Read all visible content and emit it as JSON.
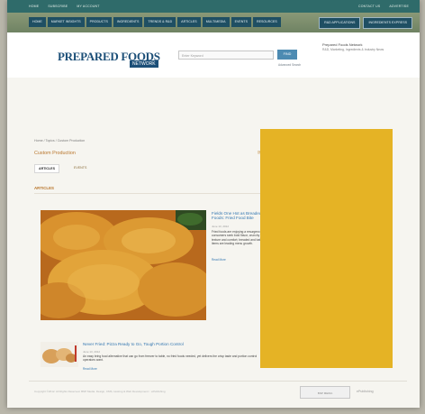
{
  "utility_bar": {
    "left_links": [
      "HOME",
      "SUBSCRIBE",
      "MY ACCOUNT"
    ],
    "right_links": [
      "CONTACT US",
      "ADVERTISE"
    ]
  },
  "nav": {
    "items": [
      "HOME",
      "MARKET INSIGHTS",
      "PRODUCTS",
      "INGREDIENTS",
      "TRENDS & R&D",
      "ARTICLES",
      "MULTIMEDIA",
      "EVENTS",
      "RESOURCES"
    ],
    "special": [
      "R&D APPLICATIONS",
      "INGREDIENTS EXPRESS"
    ]
  },
  "header": {
    "logo_main": "PREPARED FOODS",
    "logo_sub": "NETWORK",
    "search_placeholder": "Enter Keyword",
    "search_button": "FIND",
    "advanced_search": "Advanced Search",
    "promo_title": "Prepared Foods Network",
    "promo_text": "R&D, Marketing, Ingredients & Industry News"
  },
  "breadcrumbs": "Home / Topics / Custom Production",
  "page_title": "Custom Production",
  "tabs": [
    "ARTICLES",
    "EVENTS"
  ],
  "section_heading": "ARTICLES",
  "article1": {
    "title": "Fields One Hot as Breaded Foods: Fried Food Bite",
    "date": "June 13, 2012",
    "summary": "Fried foods are enjoying a resurgence as consumers seek bold flavor, crunchy texture and comfort; breaded and battered items are leading menu growth.",
    "more": "Read More"
  },
  "article2": {
    "title": "Never Fried: Pizza Ready to Go, Tough Portion Control",
    "date": "June 13, 2012",
    "summary": "An easy bring food alternative that can go from freezer to table, no fried foods needed, yet delivers the crisp taste and portion control operators want.",
    "more": "Read More"
  },
  "footer": {
    "text": "Copyright ©2012. All Rights Reserved. BNP Media. Design, CMS, Hosting & Web Development :: ePublishing",
    "badge": "BNP MEDIA",
    "brand": "ePublishing"
  },
  "colors": {
    "nav_bg": "#1f4f63",
    "header_band": "#7c8d6c",
    "accent_orange": "#b8752b",
    "link_blue": "#3477b1",
    "ad_block": "#e5b325"
  }
}
